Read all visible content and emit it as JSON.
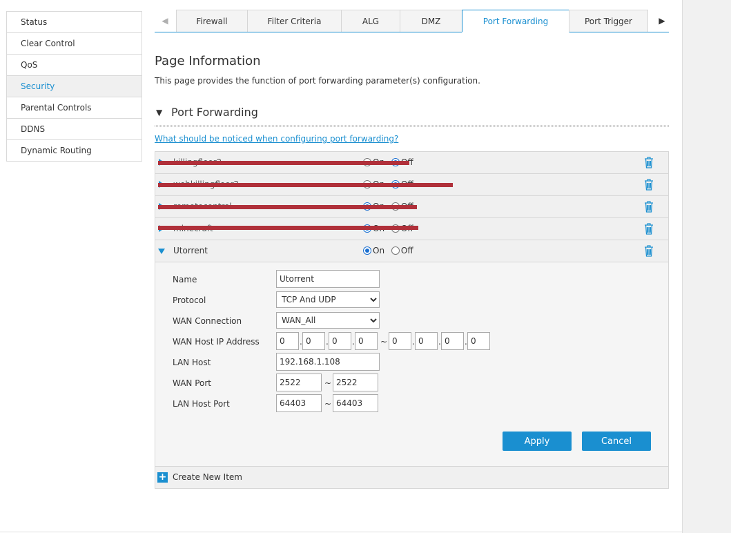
{
  "sidebar": {
    "items": [
      {
        "label": "Status"
      },
      {
        "label": "Clear Control"
      },
      {
        "label": "QoS"
      },
      {
        "label": "Security"
      },
      {
        "label": "Parental Controls"
      },
      {
        "label": "DDNS"
      },
      {
        "label": "Dynamic Routing"
      }
    ],
    "active": "Security"
  },
  "tabs": {
    "items": [
      {
        "label": "Firewall"
      },
      {
        "label": "Filter Criteria"
      },
      {
        "label": "ALG"
      },
      {
        "label": "DMZ"
      },
      {
        "label": "Port Forwarding"
      },
      {
        "label": "Port Trigger"
      }
    ],
    "active": "Port Forwarding",
    "left_arrow": "◀",
    "right_arrow": "▶"
  },
  "page": {
    "title": "Page Information",
    "description": "This page provides the function of port forwarding parameter(s) configuration.",
    "section_title": "Port Forwarding",
    "section_arrow": "▼",
    "notice_link": "What should be noticed when configuring port forwarding?"
  },
  "rules": [
    {
      "name": "killingfloor2",
      "on_label": "On",
      "off_label": "Off",
      "state": "off",
      "redacted": true
    },
    {
      "name": "webkillingfloor2",
      "on_label": "On",
      "off_label": "Off",
      "state": "off",
      "redacted": true
    },
    {
      "name": "remotecontrol",
      "on_label": "On",
      "off_label": "Off",
      "state": "on",
      "redacted": true
    },
    {
      "name": "minecraft",
      "on_label": "On",
      "off_label": "Off",
      "state": "on",
      "redacted": true
    },
    {
      "name": "Utorrent",
      "on_label": "On",
      "off_label": "Off",
      "state": "on",
      "redacted": false,
      "expanded": true
    }
  ],
  "form": {
    "name_label": "Name",
    "name_value": "Utorrent",
    "protocol_label": "Protocol",
    "protocol_value": "TCP And UDP",
    "wan_connection_label": "WAN Connection",
    "wan_connection_value": "WAN_All",
    "wan_host_ip_label": "WAN Host IP Address",
    "wan_ip_start": [
      "0",
      "0",
      "0",
      "0"
    ],
    "wan_ip_end": [
      "0",
      "0",
      "0",
      "0"
    ],
    "lan_host_label": "LAN Host",
    "lan_host_value": "192.168.1.108",
    "wan_port_label": "WAN Port",
    "wan_port_start": "2522",
    "wan_port_end": "2522",
    "lan_host_port_label": "LAN Host Port",
    "lan_port_start": "64403",
    "lan_port_end": "64403",
    "range_sep": "~",
    "dot_sep": ".",
    "apply_label": "Apply",
    "cancel_label": "Cancel"
  },
  "create_item_label": "Create New Item",
  "colors": {
    "accent": "#1a8fd0",
    "redaction": "#b0303a"
  }
}
